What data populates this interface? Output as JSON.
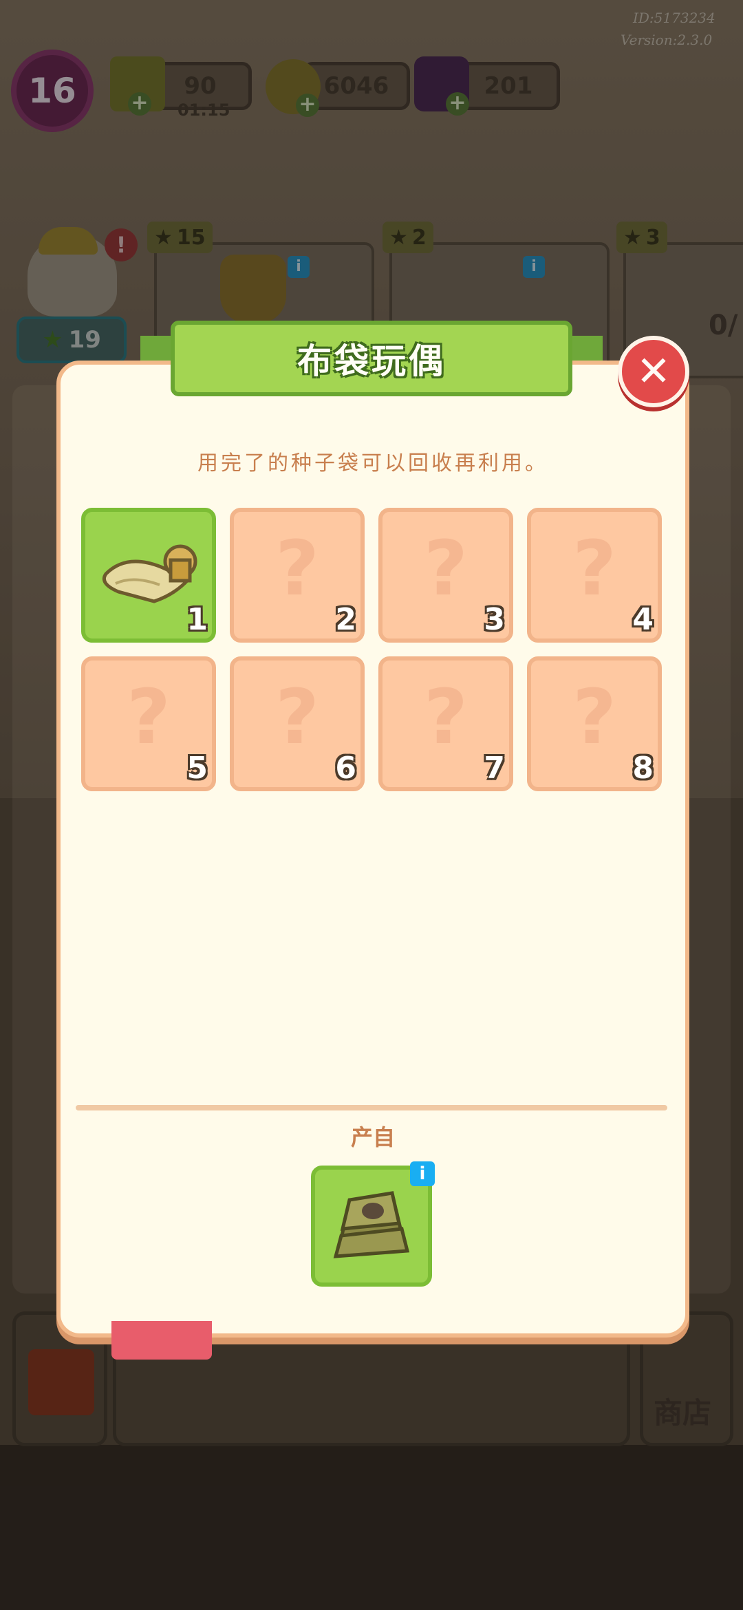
{
  "hud": {
    "player_id": "ID:5173234",
    "version": "Version:2.3.0",
    "level": "16",
    "energy": "90",
    "energy_timer": "01:15",
    "coins": "6046",
    "gems": "201"
  },
  "background": {
    "order_stars": [
      "15",
      "2",
      "3"
    ],
    "worker_stars": "19",
    "partial_text": "0/",
    "shop_label": "商店"
  },
  "modal": {
    "title": "布袋玩偶",
    "description": "用完了的种子袋可以回收再利用。",
    "slots": [
      {
        "number": "1",
        "state": "unlocked",
        "item": "scroll-with-spool"
      },
      {
        "number": "2",
        "state": "locked",
        "placeholder": "?"
      },
      {
        "number": "3",
        "state": "locked",
        "placeholder": "?"
      },
      {
        "number": "4",
        "state": "locked",
        "placeholder": "?"
      },
      {
        "number": "5",
        "state": "locked",
        "placeholder": "?"
      },
      {
        "number": "6",
        "state": "locked",
        "placeholder": "?"
      },
      {
        "number": "7",
        "state": "locked",
        "placeholder": "?"
      },
      {
        "number": "8",
        "state": "locked",
        "placeholder": "?"
      }
    ],
    "produce_label": "产自",
    "produce_item": "seed-bag-stack",
    "info_label": "i",
    "close_label": "✕"
  },
  "colors": {
    "accent_green": "#9ad34d",
    "locked_peach": "#fec8a1",
    "close_red": "#e24a4a",
    "text_brown": "#c87f4e"
  }
}
